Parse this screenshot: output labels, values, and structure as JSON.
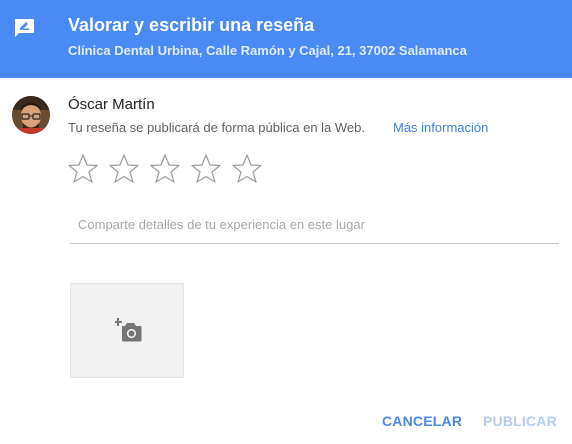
{
  "header": {
    "title": "Valorar y escribir una reseña",
    "subtitle": "Clínica Dental Urbina, Calle Ramón y Cajal, 21, 37002 Salamanca",
    "icon": "rate-review-icon",
    "background_color": "#4a8af4"
  },
  "user": {
    "name": "Óscar Martín",
    "notice": "Tu reseña se publicará de forma pública en la Web.",
    "more_info_link": "Más información"
  },
  "rating": {
    "max": 5,
    "selected": 0,
    "icon": "star-outline-icon"
  },
  "review": {
    "placeholder": "Comparte detalles de tu experiencia en este lugar",
    "value": ""
  },
  "photo": {
    "icon": "add-photo-icon"
  },
  "actions": {
    "cancel_label": "CANCELAR",
    "publish_label": "PUBLICAR",
    "accent_color": "#4a86e6",
    "disabled_color": "#b4cbf2"
  }
}
